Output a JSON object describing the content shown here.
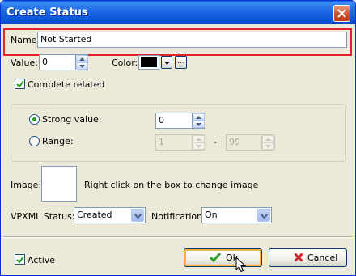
{
  "window": {
    "title": "Create Status"
  },
  "name": {
    "label": "Name",
    "value": "Not Started"
  },
  "value_field": {
    "label": "Value:",
    "value": "0"
  },
  "color_field": {
    "label": "Color:",
    "swatch": "#000000",
    "more_label": "..."
  },
  "complete_related": {
    "label": "Complete related",
    "checked": true
  },
  "strong_value": {
    "label": "Strong value:",
    "value": "0",
    "selected": true
  },
  "range": {
    "label": "Range:",
    "from": "1",
    "separator": "-",
    "to": "99",
    "selected": false
  },
  "image": {
    "label": "Image:",
    "hint": "Right click on the box to  change image"
  },
  "vpxml_status": {
    "label": "VPXML Status:",
    "value": "Created"
  },
  "notification": {
    "label": "Notification:",
    "value": "On"
  },
  "active": {
    "label": "Active",
    "checked": true
  },
  "buttons": {
    "ok_label": "Ok",
    "cancel_label": "Cancel"
  },
  "colors": {
    "highlight": "#e0252a",
    "title_bar": "#0a52d4",
    "ok_check": "#2f9e2f",
    "cancel_x": "#d7262b"
  }
}
